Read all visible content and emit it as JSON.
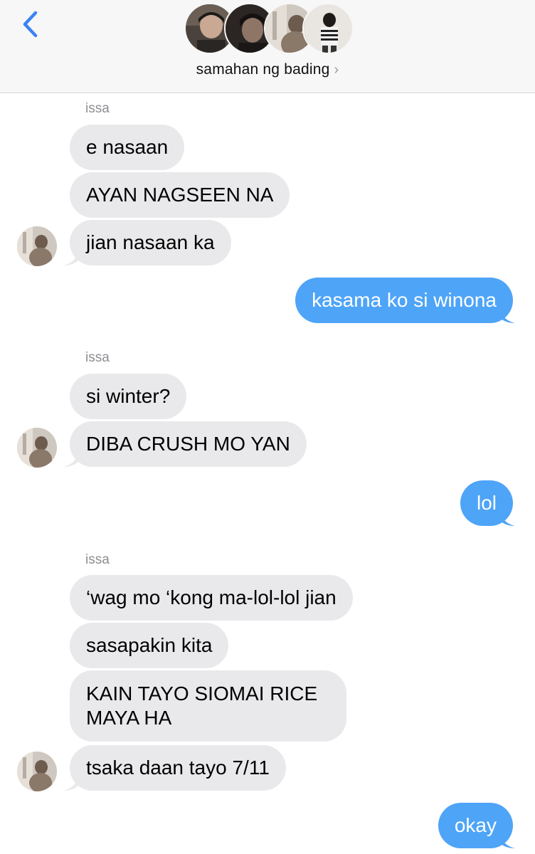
{
  "header": {
    "group_name": "samahan ng bading",
    "chevron": "›",
    "back_icon": "chevron-left-icon",
    "accent": "#3a82f7"
  },
  "messages": [
    {
      "sender": "issa"
    },
    {
      "text": "e nasaan"
    },
    {
      "text": "AYAN NAGSEEN NA"
    },
    {
      "text": "jian nasaan ka"
    },
    {
      "text": "kasama ko si winona"
    },
    {
      "sender": "issa"
    },
    {
      "text": "si winter?"
    },
    {
      "text": "DIBA CRUSH MO YAN"
    },
    {
      "text": "lol"
    },
    {
      "sender": "issa"
    },
    {
      "text": "‘wag mo ‘kong ma-lol-lol jian"
    },
    {
      "text": "sasapakin kita"
    },
    {
      "text": "KAIN TAYO SIOMAI RICE MAYA HA"
    },
    {
      "text": "tsaka daan tayo 7/11"
    },
    {
      "text": "okay"
    }
  ],
  "colors": {
    "incoming_bubble": "#e9e9eb",
    "outgoing_bubble": "#4ea4f7"
  }
}
